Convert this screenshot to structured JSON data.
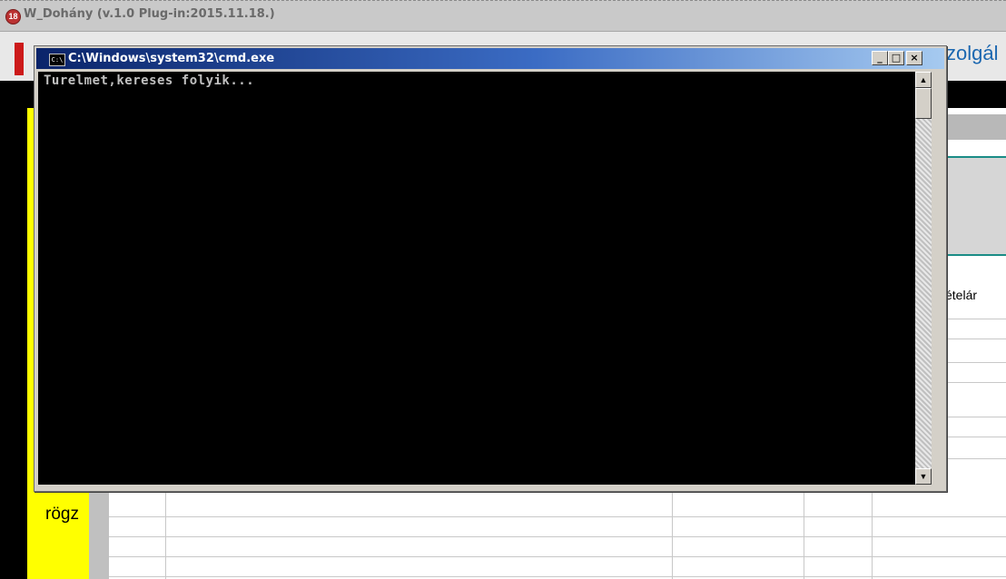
{
  "background_app": {
    "title": "W_Dohány  (v.1.0 Plug-in:2015.11.18.)",
    "toolbar_label_partial": "zolgál",
    "column_header_partial": "ételár",
    "yellow_panel_label_partial": "rögz",
    "app_icon_glyph": "18",
    "colors": {
      "yellow_panel": "#ffff00",
      "accent_blue": "#1b67b0",
      "teal": "#1b8c86",
      "red_button": "#cc1a1a"
    }
  },
  "cmd_window": {
    "title": "C:\\Windows\\system32\\cmd.exe",
    "icon_label": "C:\\",
    "output_lines": [
      "Turelmet,kereses folyik..."
    ],
    "controls": {
      "minimize": "_",
      "maximize": "□",
      "close": "×"
    },
    "scrollbar": {
      "up": "▲",
      "down": "▼"
    }
  }
}
